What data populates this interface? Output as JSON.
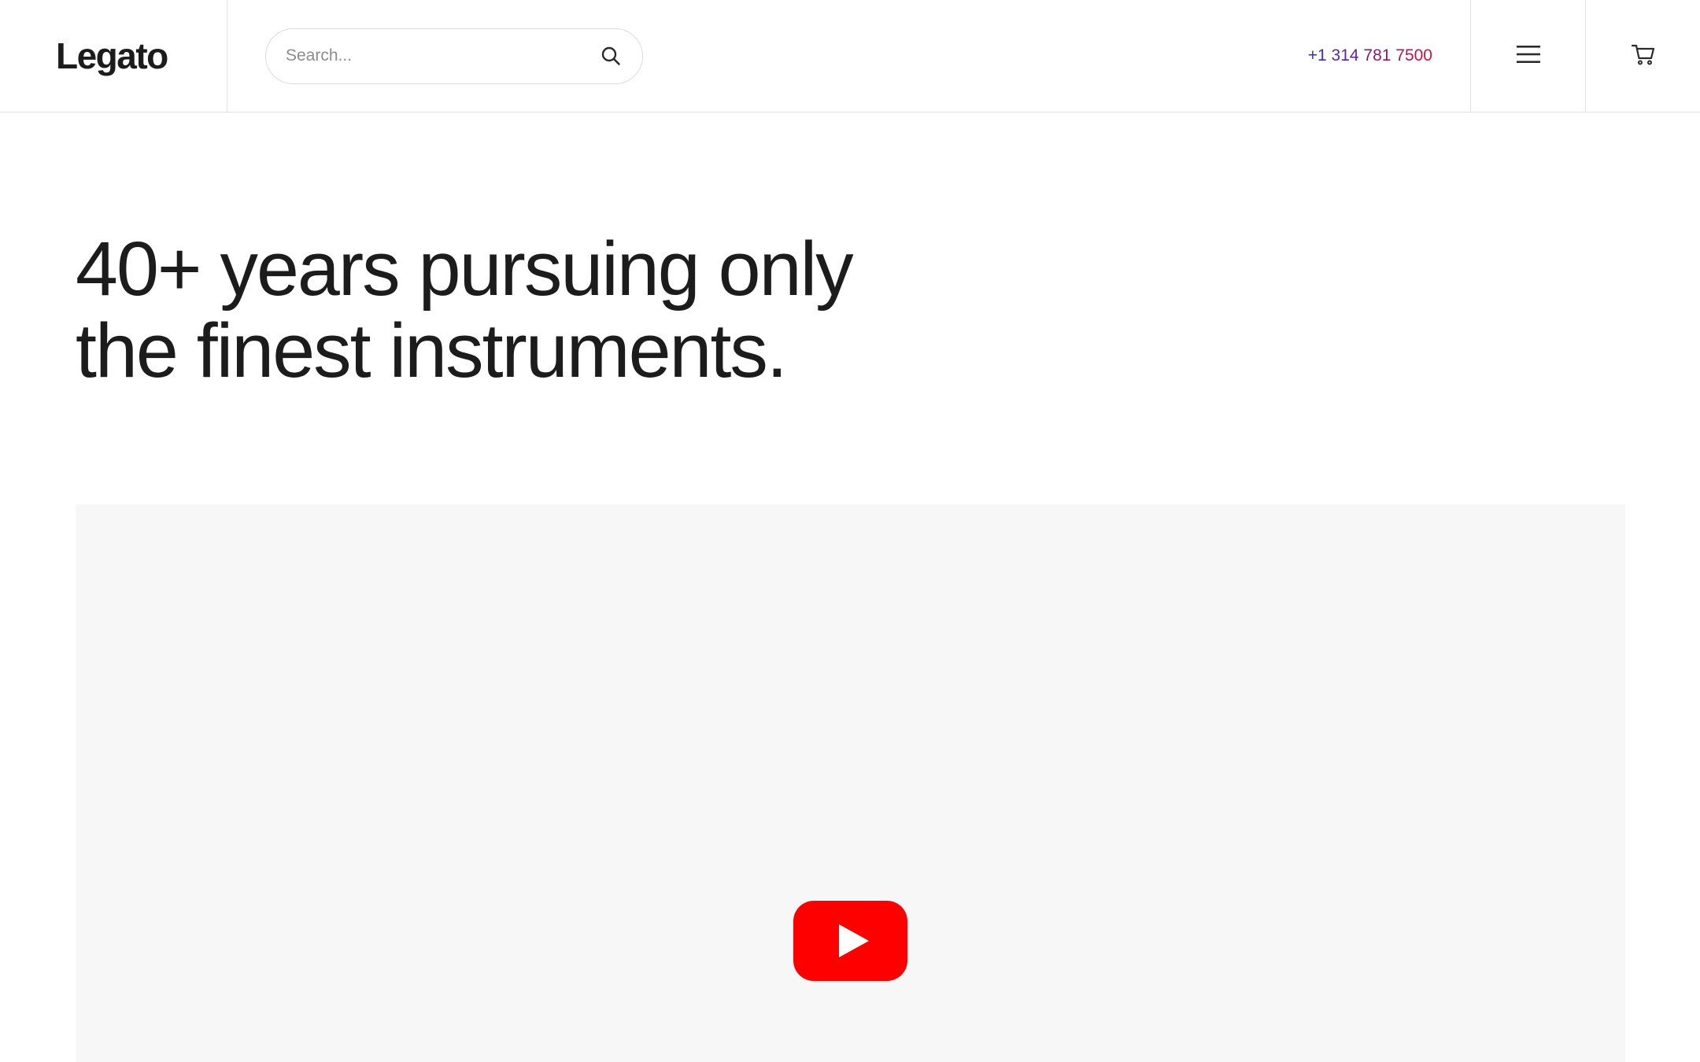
{
  "header": {
    "logo": "Legato",
    "search": {
      "placeholder": "Search...",
      "value": ""
    },
    "phone": "+1 314 781 7500",
    "icons": {
      "search": "search-icon",
      "menu": "hamburger-menu-icon",
      "cart": "shopping-cart-icon"
    }
  },
  "hero": {
    "line1": "40+ years pursuing only",
    "line2": "the finest instruments."
  },
  "video": {
    "play_icon": "youtube-play-icon",
    "background": "#f7f7f7",
    "play_color": "#ff0000"
  },
  "colors": {
    "text": "#1c1c1c",
    "border": "#e2e2e2",
    "phone_gradient_start": "#2a2fd6",
    "phone_gradient_end": "#d6123a"
  }
}
